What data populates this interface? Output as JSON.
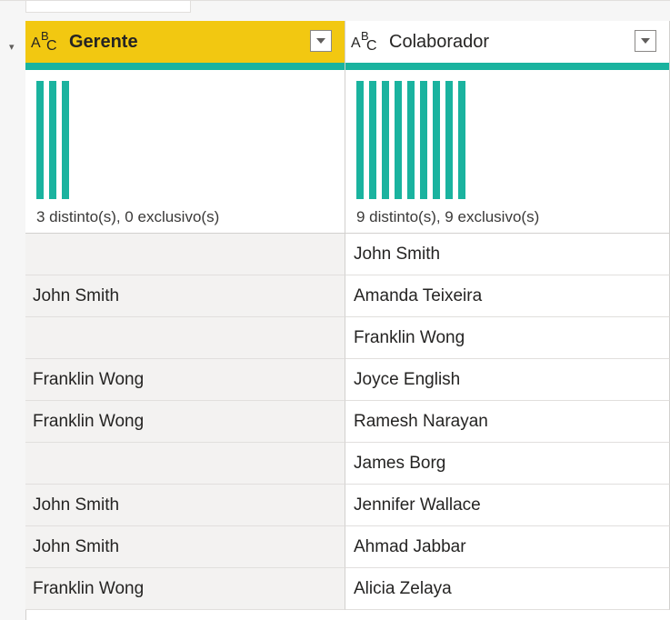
{
  "columns": [
    {
      "title": "Gerente",
      "type_icon": "text-type-icon",
      "profile": "3 distinto(s), 0 exclusivo(s)",
      "distinct_count": 3,
      "cells": [
        "",
        "John Smith",
        "",
        "Franklin Wong",
        "Franklin Wong",
        "",
        "John Smith",
        "John Smith",
        "Franklin Wong"
      ]
    },
    {
      "title": "Colaborador",
      "type_icon": "text-type-icon",
      "profile": "9 distinto(s), 9 exclusivo(s)",
      "distinct_count": 9,
      "cells": [
        "John Smith",
        "Amanda Teixeira",
        "Franklin Wong",
        "Joyce English",
        "Ramesh Narayan",
        "James Borg",
        "Jennifer Wallace",
        "Ahmad Jabbar",
        "Alicia Zelaya"
      ]
    }
  ],
  "type_glyph": {
    "a": "A",
    "b": "B",
    "c": "C"
  },
  "colors": {
    "selected_header": "#f2c811",
    "quality_valid": "#1ab39f",
    "empty_cell": "#f3f2f1"
  }
}
